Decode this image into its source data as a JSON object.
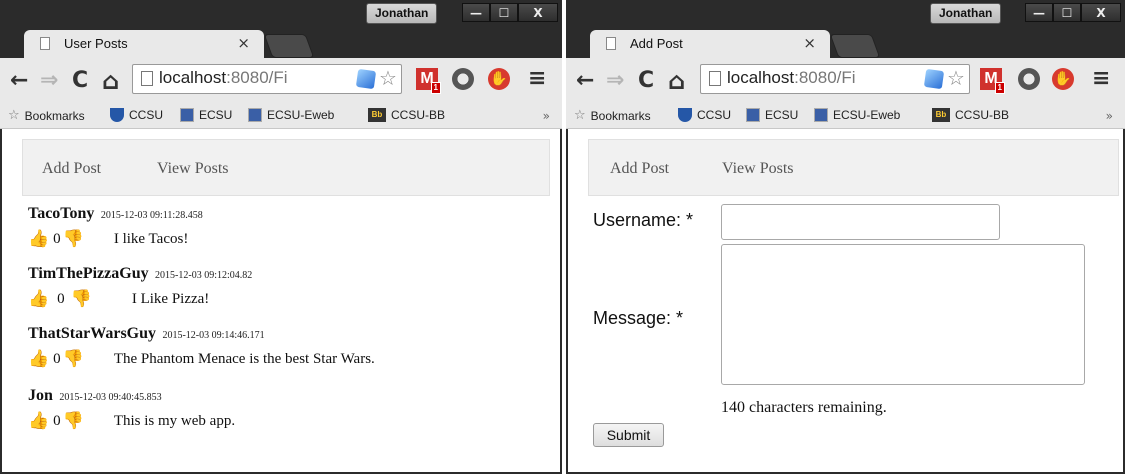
{
  "windows": [
    {
      "user": "Jonathan",
      "window_buttons": [
        "—",
        "☐",
        "X"
      ],
      "tab_title": "User Posts",
      "url_host": "localhost",
      "url_rest": ":8080/Fi",
      "ext_m_badge": "1",
      "bookmarks": [
        "Bookmarks",
        "CCSU",
        "ECSU",
        "ECSU-Eweb",
        "CCSU-BB"
      ],
      "bb_icon": "Bb",
      "bookmarks_more": "»",
      "nav": [
        "Add Post",
        "View Posts"
      ]
    },
    {
      "user": "Jonathan",
      "window_buttons": [
        "—",
        "☐",
        "X"
      ],
      "tab_title": "Add Post",
      "url_host": "localhost",
      "url_rest": ":8080/Fi",
      "ext_m_badge": "1",
      "bookmarks": [
        "Bookmarks",
        "CCSU",
        "ECSU",
        "ECSU-Eweb",
        "CCSU-BB"
      ],
      "bb_icon": "Bb",
      "bookmarks_more": "»",
      "nav": [
        "Add Post",
        "View Posts"
      ]
    }
  ],
  "posts": [
    {
      "user": "TacoTony",
      "time": "2015-12-03 09:11:28.458",
      "likes": "0",
      "message": "I like Tacos!"
    },
    {
      "user": "TimThePizzaGuy",
      "time": "2015-12-03 09:12:04.82",
      "likes": "0",
      "message": "I Like Pizza!"
    },
    {
      "user": "ThatStarWarsGuy",
      "time": "2015-12-03 09:14:46.171",
      "likes": "0",
      "message": "The Phantom Menace is the best Star Wars."
    },
    {
      "user": "Jon",
      "time": "2015-12-03 09:40:45.853",
      "likes": "0",
      "message": "This is my web app."
    }
  ],
  "form": {
    "username_label": "Username: *",
    "username_value": "",
    "message_label": "Message: *",
    "message_value": "",
    "remaining": "140 characters remaining.",
    "submit": "Submit"
  },
  "icons": {
    "thumb_up": "👍",
    "thumb_down": "👎",
    "back": "←",
    "forward": "⇒",
    "reload": "C",
    "home": "⌂",
    "star": "☆",
    "menu": "≡",
    "close": "×",
    "stop": "✋"
  }
}
